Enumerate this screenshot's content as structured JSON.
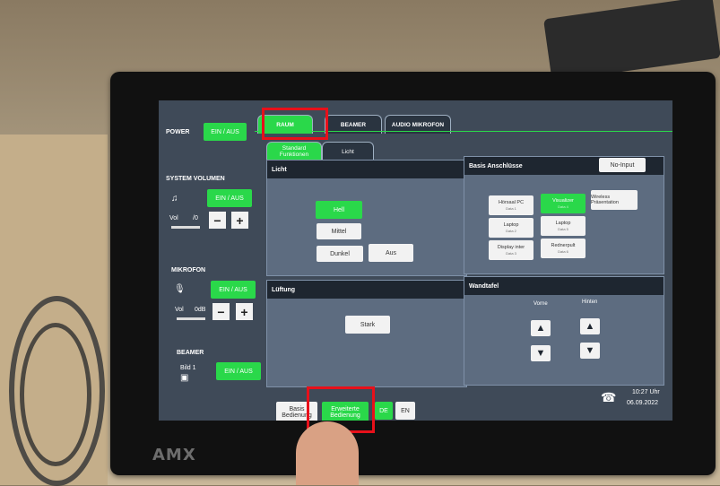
{
  "brand": "AMX",
  "power": {
    "label": "POWER",
    "button": "EIN / AUS"
  },
  "system_volume": {
    "label": "SYSTEM VOLUMEN",
    "button": "EIN / AUS",
    "vol_label": "Vol",
    "vol_value": "/0",
    "minus": "−",
    "plus": "+"
  },
  "mikrofon": {
    "label": "MIKROFON",
    "button": "EIN / AUS",
    "vol_label": "Vol",
    "vol_value": "0dB",
    "minus": "−",
    "plus": "+"
  },
  "beamer": {
    "label": "BEAMER",
    "bild_label": "Bild 1",
    "button": "EIN / AUS"
  },
  "tabs": [
    {
      "label": "RAUM",
      "active": true
    },
    {
      "label": "BEAMER",
      "active": false
    },
    {
      "label": "AUDIO MIKROFON",
      "active": false
    }
  ],
  "subtabs": [
    {
      "label": "Standard Funktionen",
      "active": true
    },
    {
      "label": "Licht",
      "active": false
    }
  ],
  "licht": {
    "title": "Licht",
    "hell": "Hell",
    "mittel": "Mittel",
    "dunkel": "Dunkel",
    "aus": "Aus"
  },
  "basis": {
    "title": "Basis Anschlüsse",
    "no_input": "No-Input",
    "inputs": [
      {
        "label": "Hörsaal PC",
        "sub": "Data 1",
        "on": false
      },
      {
        "label": "Visualizer",
        "sub": "Data 4",
        "on": true
      },
      {
        "label": "Wireless Präsentation",
        "sub": "",
        "on": false
      },
      {
        "label": "Laptop",
        "sub": "Data 2",
        "on": false
      },
      {
        "label": "Laptop",
        "sub": "Data 5",
        "on": false
      },
      {
        "label": "Display inter",
        "sub": "Data 3",
        "on": false
      },
      {
        "label": "Rednerpult",
        "sub": "Data 6",
        "on": false
      }
    ]
  },
  "lueftung": {
    "title": "Lüftung",
    "stark": "Stark"
  },
  "wandtafel": {
    "title": "Wandtafel",
    "vorne": "Vorne",
    "hinten": "Hinten",
    "up": "▲",
    "down": "▼"
  },
  "footer": {
    "basis_bedienung": "Basis Bedienung",
    "erweiterte_bedienung": "Erweiterte Bedienung",
    "de": "DE",
    "en": "EN",
    "time": "10:27 Uhr",
    "date": "06.09.2022"
  },
  "colors": {
    "accent": "#2ad84a",
    "highlight": "#e8101a",
    "panel": "#5d6c80"
  }
}
